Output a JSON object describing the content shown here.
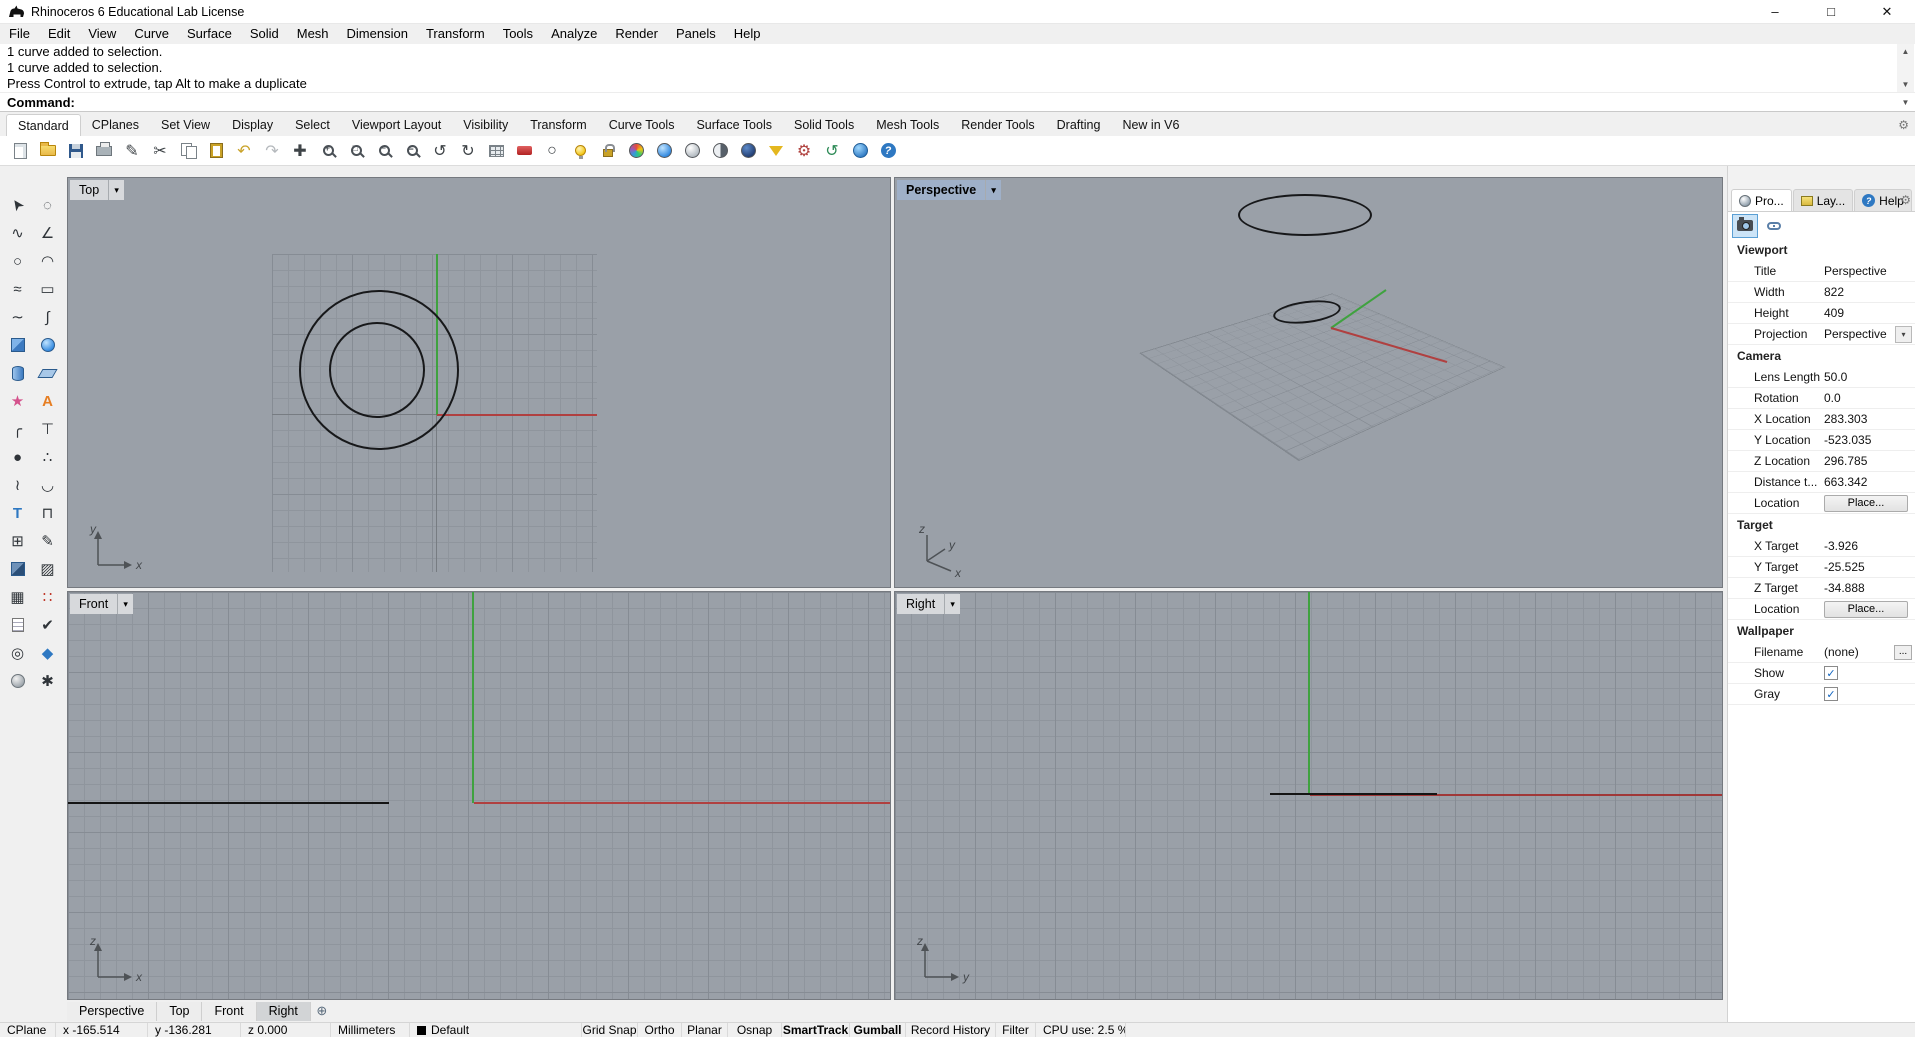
{
  "window": {
    "title": "Rhinoceros 6 Educational Lab License"
  },
  "menu": {
    "items": [
      "File",
      "Edit",
      "View",
      "Curve",
      "Surface",
      "Solid",
      "Mesh",
      "Dimension",
      "Transform",
      "Tools",
      "Analyze",
      "Render",
      "Panels",
      "Help"
    ]
  },
  "command_area": {
    "history": [
      "1 curve added to selection.",
      "1 curve added to selection.",
      "Press Control to extrude, tap Alt to make a duplicate"
    ],
    "prompt_label": "Command:",
    "input_value": ""
  },
  "toolbar_tabs": {
    "items": [
      "Standard",
      "CPlanes",
      "Set View",
      "Display",
      "Select",
      "Viewport Layout",
      "Visibility",
      "Transform",
      "Curve Tools",
      "Surface Tools",
      "Solid Tools",
      "Mesh Tools",
      "Render Tools",
      "Drafting",
      "New in V6"
    ],
    "active": "Standard"
  },
  "standard_toolbar": {
    "icons": [
      "new-file",
      "open-file",
      "save",
      "print",
      "page-edit",
      "cut",
      "copy",
      "paste",
      "undo",
      "redo",
      "pan-view",
      "zoom-dynamic",
      "zoom-window",
      "zoom-extents",
      "zoom-extents-all",
      "undo-view",
      "rotate-view",
      "named-views",
      "delete",
      "hide",
      "lamp",
      "lock",
      "render-display",
      "shaded-display",
      "ghosted-display",
      "xray-display",
      "rendered-display",
      "selection-filter",
      "options",
      "history",
      "web-browser",
      "help"
    ]
  },
  "tool_palette": {
    "icons": [
      "select",
      "lasso-select",
      "control-point-curve",
      "polyline",
      "circle",
      "arc",
      "curve",
      "rectangle",
      "freeform-curve",
      "helix",
      "box",
      "sphere",
      "cylinder",
      "plane",
      "surface-star",
      "annotate",
      "fillet",
      "dimension",
      "point",
      "points",
      "adjust-curve",
      "blend-curve",
      "text",
      "clamp",
      "array",
      "pencil",
      "solid",
      "hatch",
      "block",
      "point-cloud",
      "notes",
      "check",
      "gumball",
      "paint",
      "render-sphere",
      "spray"
    ]
  },
  "viewports": {
    "top": {
      "title": "Top",
      "axes": {
        "up": "y",
        "right": "x"
      }
    },
    "perspective": {
      "title": "Perspective",
      "active": true,
      "axes": {
        "up": "z",
        "mid": "y",
        "low": "x"
      }
    },
    "front": {
      "title": "Front",
      "axes": {
        "up": "z",
        "right": "x"
      }
    },
    "right": {
      "title": "Right",
      "axes": {
        "up": "z",
        "right": "y"
      }
    }
  },
  "viewport_tabs": {
    "items": [
      "Perspective",
      "Top",
      "Front",
      "Right"
    ],
    "active": "Right"
  },
  "properties_panel": {
    "tabs": [
      {
        "label": "Pro..."
      },
      {
        "label": "Lay..."
      },
      {
        "label": "Help"
      }
    ],
    "active_tab": "Pro...",
    "sections": {
      "viewport": {
        "title": "Viewport",
        "rows": {
          "title": {
            "label": "Title",
            "value": "Perspective"
          },
          "width": {
            "label": "Width",
            "value": "822"
          },
          "height": {
            "label": "Height",
            "value": "409"
          },
          "projection": {
            "label": "Projection",
            "value": "Perspective"
          }
        }
      },
      "camera": {
        "title": "Camera",
        "rows": {
          "lens_length": {
            "label": "Lens Length",
            "value": "50.0"
          },
          "rotation": {
            "label": "Rotation",
            "value": "0.0"
          },
          "x_location": {
            "label": "X Location",
            "value": "283.303"
          },
          "y_location": {
            "label": "Y Location",
            "value": "-523.035"
          },
          "z_location": {
            "label": "Z Location",
            "value": "296.785"
          },
          "distance": {
            "label": "Distance t...",
            "value": "663.342"
          },
          "location": {
            "label": "Location",
            "button_label": "Place..."
          }
        }
      },
      "target": {
        "title": "Target",
        "rows": {
          "x_target": {
            "label": "X Target",
            "value": "-3.926"
          },
          "y_target": {
            "label": "Y Target",
            "value": "-25.525"
          },
          "z_target": {
            "label": "Z Target",
            "value": "-34.888"
          },
          "location": {
            "label": "Location",
            "button_label": "Place..."
          }
        }
      },
      "wallpaper": {
        "title": "Wallpaper",
        "rows": {
          "filename": {
            "label": "Filename",
            "value": "(none)",
            "browse_label": "..."
          },
          "show": {
            "label": "Show",
            "checked": true
          },
          "gray": {
            "label": "Gray",
            "checked": true
          }
        }
      }
    }
  },
  "status_bar": {
    "cplane_label": "CPlane",
    "x_coord": "x -165.514",
    "y_coord": "y -136.281",
    "z_coord": "z 0.000",
    "units": "Millimeters",
    "layer": "Default",
    "toggles": [
      "Grid Snap",
      "Ortho",
      "Planar",
      "Osnap",
      "SmartTrack",
      "Gumball",
      "Record History",
      "Filter"
    ],
    "enabled_toggles": [
      "SmartTrack",
      "Gumball"
    ],
    "cpu": "CPU use: 2.5 %"
  },
  "colors": {
    "viewport_bg": "#9AA0A8",
    "grid_line": "#8F959D",
    "grid_major": "#868C94",
    "x_axis": "#B04040",
    "y_axis": "#3FA23F",
    "curve": "#17181A"
  }
}
